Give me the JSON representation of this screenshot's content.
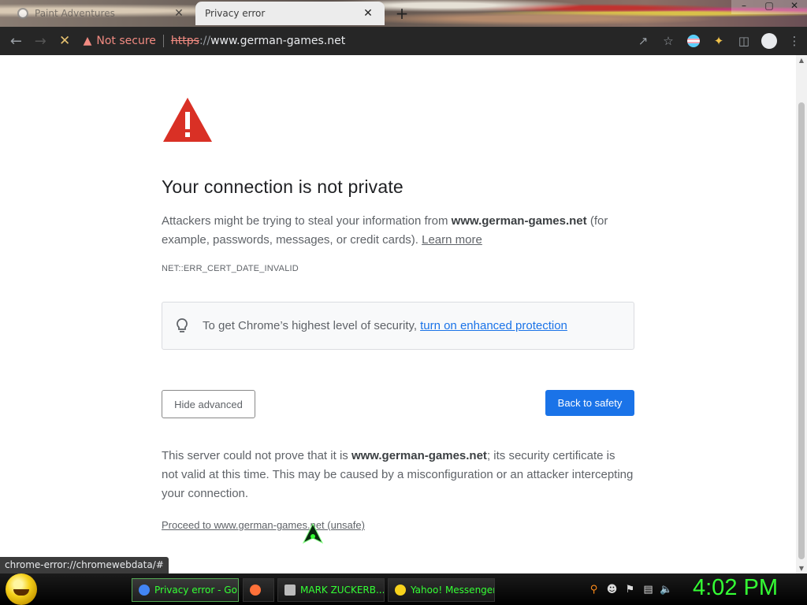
{
  "browser": {
    "tabs": [
      {
        "title": "Paint Adventures",
        "active": false
      },
      {
        "title": "Privacy error",
        "active": true
      }
    ],
    "new_tab_symbol": "+",
    "tab_close_symbol": "✕",
    "window_controls": [
      "–",
      "▢",
      "✕"
    ],
    "security_label": "Not secure",
    "url_scheme": "https",
    "url_slashes": "://",
    "url_host": "www.german-games.net",
    "toolbar_icons": [
      "share-icon",
      "bookmark-star-icon",
      "extension-flag-icon",
      "puzzle-extension-icon",
      "side-panel-icon",
      "profile-icon",
      "menu-icon"
    ]
  },
  "page": {
    "heading": "Your connection is not private",
    "intro_prefix": "Attackers might be trying to steal your information from ",
    "intro_host": "www.german-games.net",
    "intro_suffix": " (for example, passwords, messages, or credit cards). ",
    "learn_more": "Learn more",
    "error_code": "NET::ERR_CERT_DATE_INVALID",
    "tip_text": "To get Chrome’s highest level of security,",
    "tip_link": "turn on enhanced protection",
    "hide_advanced": "Hide advanced",
    "back_to_safety": "Back to safety",
    "details_prefix": "This server could not prove that it is ",
    "details_host": "www.german-games.net",
    "details_suffix": "; its security certificate is not valid at this time. This may be caused by a misconfiguration or an attacker intercepting your connection.",
    "proceed_link": "Proceed to www.german-games.net (unsafe)"
  },
  "status_url": "chrome-error://chromewebdata/#",
  "taskbar": {
    "tasks": [
      {
        "label": "Privacy error - Go...",
        "icon_color": "#4285f4",
        "active": true
      },
      {
        "label": "",
        "icon_color": "#ff7139",
        "active": false
      },
      {
        "label": "MARK ZUCKERB...",
        "icon_color": "#bbbbbb",
        "active": false
      },
      {
        "label": "Yahoo! Messenger",
        "icon_color": "#f7d21c",
        "active": false
      }
    ],
    "clock": "4:02 PM"
  },
  "colors": {
    "accent_blue": "#1a73e8",
    "warning_red": "#d93025",
    "taskbar_green": "#34ff34"
  }
}
